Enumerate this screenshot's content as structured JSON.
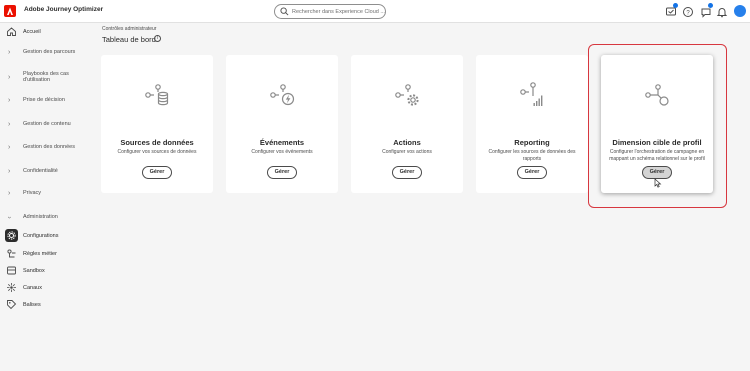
{
  "header": {
    "app_title": "Adobe Journey Optimizer",
    "search_placeholder": "Rechercher dans Experience Cloud ...",
    "accent_color": "#eb1000"
  },
  "sidebar": {
    "items": [
      {
        "label": "Accueil",
        "icon": "home-icon"
      },
      {
        "label": "Gestion des parcours",
        "icon": "chevron-right-icon"
      },
      {
        "label": "Playbooks des cas d'utilisation",
        "icon": "chevron-right-icon"
      },
      {
        "label": "Prise de décision",
        "icon": "chevron-right-icon"
      },
      {
        "label": "Gestion de contenu",
        "icon": "chevron-right-icon"
      },
      {
        "label": "Gestion des données",
        "icon": "chevron-right-icon"
      },
      {
        "label": "Confidentialité",
        "icon": "chevron-right-icon"
      },
      {
        "label": "Privacy",
        "icon": "chevron-right-icon"
      },
      {
        "label": "Administration",
        "icon": "chevron-down-icon"
      },
      {
        "label": "Configurations",
        "icon": "gear-icon",
        "active": true
      },
      {
        "label": "Règles métier",
        "icon": "rules-icon"
      },
      {
        "label": "Sandbox",
        "icon": "sandbox-icon"
      },
      {
        "label": "Canaux",
        "icon": "channels-icon"
      },
      {
        "label": "Balises",
        "icon": "tag-icon"
      }
    ]
  },
  "main": {
    "breadcrumb": "Contrôles administrateur",
    "title": "Tableau de bord",
    "cards": [
      {
        "title": "Sources de données",
        "description": "Configurer vos sources de données",
        "button": "Gérer",
        "icon": "database-flow-icon"
      },
      {
        "title": "Événements",
        "description": "Configurer vos événements",
        "button": "Gérer",
        "icon": "lightning-flow-icon"
      },
      {
        "title": "Actions",
        "description": "Configurer vos actions",
        "button": "Gérer",
        "icon": "gear-flow-icon"
      },
      {
        "title": "Reporting",
        "description": "Configurer les sources de données des rapports",
        "button": "Gérer",
        "icon": "chart-flow-icon"
      },
      {
        "title": "Dimension cible de profil",
        "description": "Configurer l'orchestration de campagne en mappant un schéma relationnel sur le profil",
        "button": "Gérer",
        "icon": "target-flow-icon",
        "highlighted": true
      }
    ]
  }
}
